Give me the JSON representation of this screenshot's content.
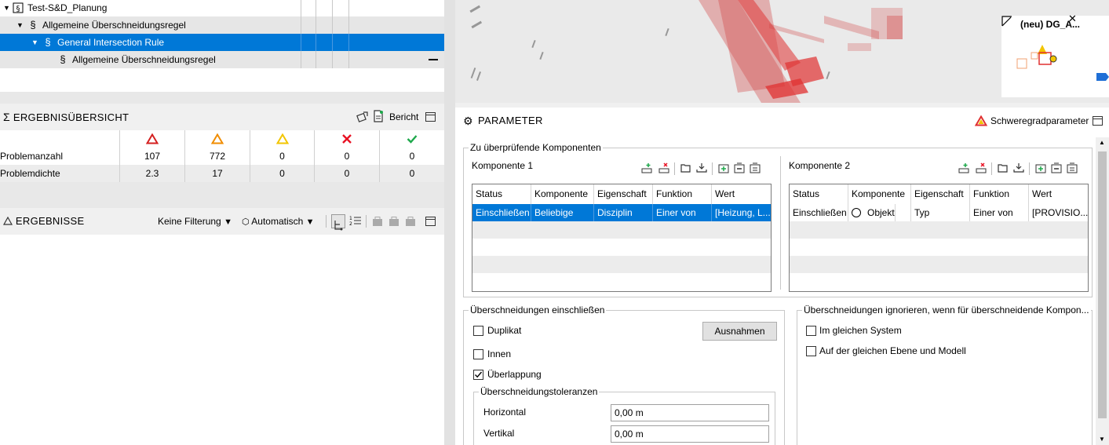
{
  "tree": {
    "rows": [
      {
        "label": "Test-S&D_Planung"
      },
      {
        "label": "Allgemeine Überschneidungsregel"
      },
      {
        "label": "General Intersection Rule"
      },
      {
        "label": "Allgemeine Überschneidungsregel"
      }
    ]
  },
  "summary": {
    "title": "ERGEBNISÜBERSICHT",
    "report_label": "Bericht",
    "rows": [
      {
        "label": "Problemanzahl",
        "values": [
          "107",
          "772",
          "0",
          "0",
          "0"
        ]
      },
      {
        "label": "Problemdichte",
        "values": [
          "2.3",
          "17",
          "0",
          "0",
          "0"
        ]
      }
    ],
    "status_colors": {
      "red": "#d42020",
      "orange": "#f08c00",
      "yellow": "#f2c500",
      "error": "#e81123",
      "ok": "#1ea84b"
    }
  },
  "results": {
    "title": "ERGEBNISSE",
    "filter_label": "Keine Filterung",
    "mode_label": "Automatisch"
  },
  "viewport": {
    "view_label": "(neu) DG_A..."
  },
  "parameter": {
    "title": "PARAMETER",
    "severity_label": "Schweregradparameter",
    "components_group": "Zu überprüfende Komponenten",
    "comp1": {
      "title": "Komponente 1",
      "headers": [
        "Status",
        "Komponente",
        "Eigenschaft",
        "Funktion",
        "Wert"
      ],
      "rows": [
        [
          "Einschließen",
          "Beliebige",
          "Disziplin",
          "Einer von",
          "[Heizung, L..."
        ]
      ]
    },
    "comp2": {
      "title": "Komponente 2",
      "headers": [
        "Status",
        "Komponente",
        "Eigenschaft",
        "Funktion",
        "Wert"
      ],
      "rows": [
        [
          "Einschließen",
          "Objekt",
          "Typ",
          "Einer von",
          "[PROVISIO..."
        ]
      ]
    },
    "include_group": "Überschneidungen einschließen",
    "include_options": [
      {
        "label": "Duplikat",
        "checked": false
      },
      {
        "label": "Innen",
        "checked": false
      },
      {
        "label": "Überlappung",
        "checked": true
      }
    ],
    "exceptions_button": "Ausnahmen",
    "tolerance_group": "Überschneidungstoleranzen",
    "tolerances": [
      {
        "label": "Horizontal",
        "value": "0,00 m"
      },
      {
        "label": "Vertikal",
        "value": "0,00 m"
      }
    ],
    "ignore_group": "Überschneidungen ignorieren, wenn für überschneidende Kompon...",
    "ignore_options": [
      {
        "label": "Im gleichen System",
        "checked": false
      },
      {
        "label": "Auf der gleichen Ebene und Modell",
        "checked": false
      }
    ]
  }
}
